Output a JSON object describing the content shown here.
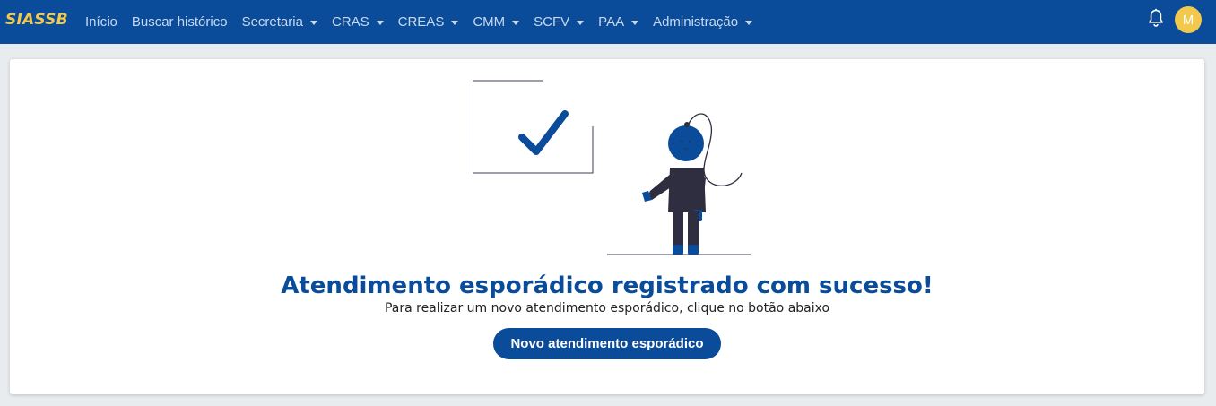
{
  "brand": "SIASSB",
  "nav": {
    "inicio": "Início",
    "buscar": "Buscar histórico",
    "secretaria": "Secretaria",
    "cras": "CRAS",
    "creas": "CREAS",
    "cmm": "CMM",
    "scfv": "SCFV",
    "paa": "PAA",
    "administracao": "Administração"
  },
  "user": {
    "avatar_initial": "M"
  },
  "icons": {
    "notifications": "bell-icon"
  },
  "colors": {
    "primary": "#0b4c9a",
    "accent": "#f2c94c"
  },
  "main": {
    "title": "Atendimento esporádico registrado com sucesso!",
    "subtitle": "Para realizar um novo atendimento esporádico, clique no botão abaixo",
    "button_label": "Novo atendimento esporádico"
  }
}
